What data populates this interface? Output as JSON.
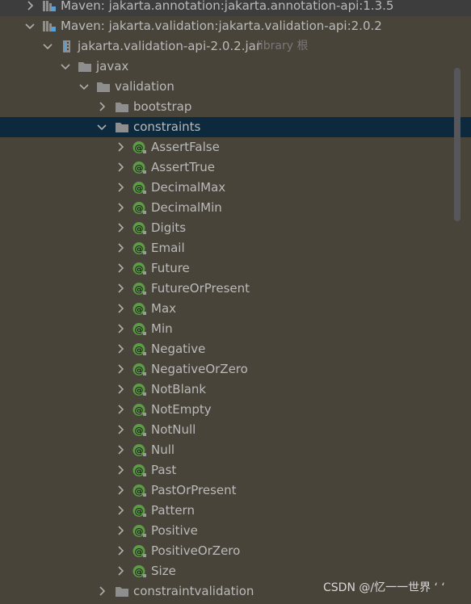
{
  "tree": {
    "top_nodes": [
      {
        "label": "Maven: jakarta.annotation:jakarta.annotation-api:1.3.5",
        "expanded": false,
        "icon": "library-icon"
      },
      {
        "label": "Maven: jakarta.validation:jakarta.validation-api:2.0.2",
        "expanded": true,
        "icon": "library-icon"
      }
    ],
    "jar": {
      "label": "jakarta.validation-api-2.0.2.jar",
      "hint": "library 根",
      "expanded": true,
      "icon": "jar-icon"
    },
    "packages": {
      "javax": {
        "label": "javax",
        "expanded": true,
        "icon": "folder-icon"
      },
      "validation": {
        "label": "validation",
        "expanded": true,
        "icon": "folder-icon"
      },
      "bootstrap": {
        "label": "bootstrap",
        "expanded": false,
        "icon": "folder-icon"
      },
      "constraints": {
        "label": "constraints",
        "expanded": true,
        "selected": true,
        "icon": "folder-icon"
      },
      "constraintvalidation": {
        "label": "constraintvalidation",
        "expanded": false,
        "icon": "folder-icon"
      }
    },
    "annotations": [
      "AssertFalse",
      "AssertTrue",
      "DecimalMax",
      "DecimalMin",
      "Digits",
      "Email",
      "Future",
      "FutureOrPresent",
      "Max",
      "Min",
      "Negative",
      "NegativeOrZero",
      "NotBlank",
      "NotEmpty",
      "NotNull",
      "Null",
      "Past",
      "PastOrPresent",
      "Pattern",
      "Positive",
      "PositiveOrZero",
      "Size"
    ],
    "annotation_icon": "annotation-icon"
  },
  "watermark": "CSDN @/忆一一世界 ‘ ‘",
  "colors": {
    "background": "#49443a",
    "selection": "#0d293e",
    "text": "#bababa",
    "hint": "#787878",
    "annotation_green": "#5d9b47",
    "folder": "#8e8e8e"
  }
}
